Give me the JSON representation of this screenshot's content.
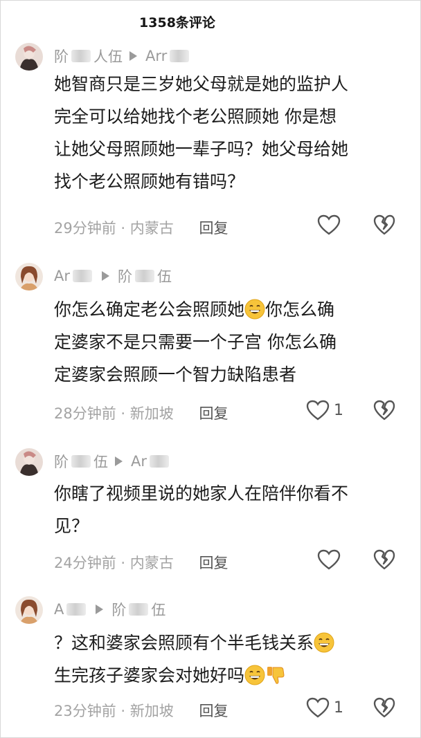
{
  "header": {
    "title": "1358条评论"
  },
  "comments": [
    {
      "user": "阶",
      "user_tail": "人伍",
      "reply_to": "Arr",
      "lines": [
        "她智商只是三岁她父母就是她的监护人",
        "完全可以给她找个老公照顾她 你是想",
        "让她父母照顾她一辈子吗？她父母给她",
        "找个老公照顾她有错吗？"
      ],
      "time": "29分钟前",
      "location": "内蒙古",
      "reply_label": "回复",
      "likes": ""
    },
    {
      "user": "Ar",
      "reply_to": "阶",
      "reply_to_tail": "伍",
      "lines": [
        "你怎么确定老公会照顾她",
        "你怎么确",
        "定婆家不是只需要一个子宫 你怎么确",
        "定婆家会照顾一个智力缺陷患者"
      ],
      "time": "28分钟前",
      "location": "新加坡",
      "reply_label": "回复",
      "likes": "1"
    },
    {
      "user": "阶",
      "user_tail": "伍",
      "reply_to": "Ar",
      "lines": [
        "你瞎了视频里说的她家人在陪伴你看不",
        "见？"
      ],
      "time": "24分钟前",
      "location": "内蒙古",
      "reply_label": "回复",
      "likes": ""
    },
    {
      "user": "A",
      "reply_to": "阶",
      "reply_to_tail": "伍",
      "lines": [
        "？这和婆家会照顾有个半毛钱关系",
        "生完孩子婆家会对她好吗"
      ],
      "time": "23分钟前",
      "location": "新加坡",
      "reply_label": "回复",
      "likes": "1"
    }
  ],
  "icons": [
    "heart-outline-icon",
    "broken-heart-icon",
    "grin-emoji-icon",
    "thumbs-down-emoji-icon",
    "reply-arrow-icon"
  ]
}
